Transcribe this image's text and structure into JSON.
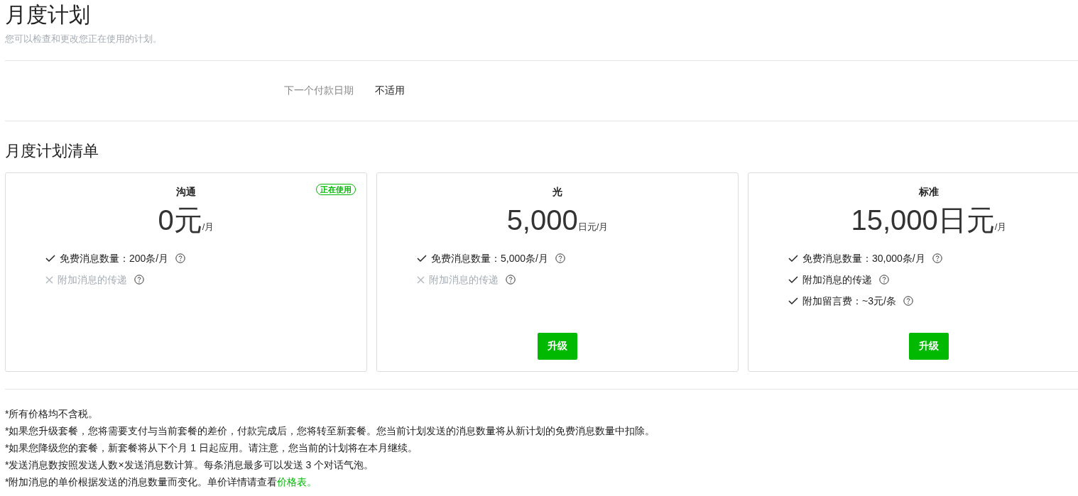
{
  "title": "月度计划",
  "subtitle": "您可以检查和更改您正在使用的计划。",
  "next_payment": {
    "label": "下一个付款日期",
    "value": "不适用"
  },
  "plans_heading": "月度计划清单",
  "plans": [
    {
      "name": "沟通",
      "current": true,
      "badge": "正在使用",
      "amount": "0元",
      "unit": "/月",
      "features": [
        {
          "kind": "included",
          "text": "免费消息数量：200条/月"
        },
        {
          "kind": "excluded",
          "text": "附加消息的传递"
        }
      ]
    },
    {
      "name": "光",
      "current": false,
      "amount": "5,000",
      "unit": "日元/月",
      "features": [
        {
          "kind": "included",
          "text": "免费消息数量：5,000条/月"
        },
        {
          "kind": "excluded",
          "text": "附加消息的传递"
        }
      ],
      "button": "升级"
    },
    {
      "name": "标准",
      "current": false,
      "amount": "15,000日元",
      "unit": "/月",
      "features": [
        {
          "kind": "included",
          "text": "免费消息数量：30,000条/月"
        },
        {
          "kind": "included",
          "text": "附加消息的传递"
        },
        {
          "kind": "included",
          "text": "附加留言费：~3元/条"
        }
      ],
      "button": "升级"
    }
  ],
  "notes": [
    [
      {
        "text": "*所有价格均不含税。"
      }
    ],
    [
      {
        "text": "*如果您升级套餐，您将需要支付与当前套餐的差价，付款完成后，您将转至新套餐。您当前计划发送的消息数量将从新计划的免费消息数量中扣除。"
      }
    ],
    [
      {
        "text": "*如果您降级您的套餐，新套餐将从下个月 1 日起应用。请注意，您当前的计划将在本月继续。"
      }
    ],
    [
      {
        "text": "*发送消息数按照发送人数×发送消息数计算。每条消息最多可以发送 3 个对话气泡。"
      }
    ],
    [
      {
        "text": "*附加消息的单价根据发送的消息数量而变化。单价详情请查看"
      },
      {
        "text": "价格表。",
        "link": true
      }
    ]
  ]
}
